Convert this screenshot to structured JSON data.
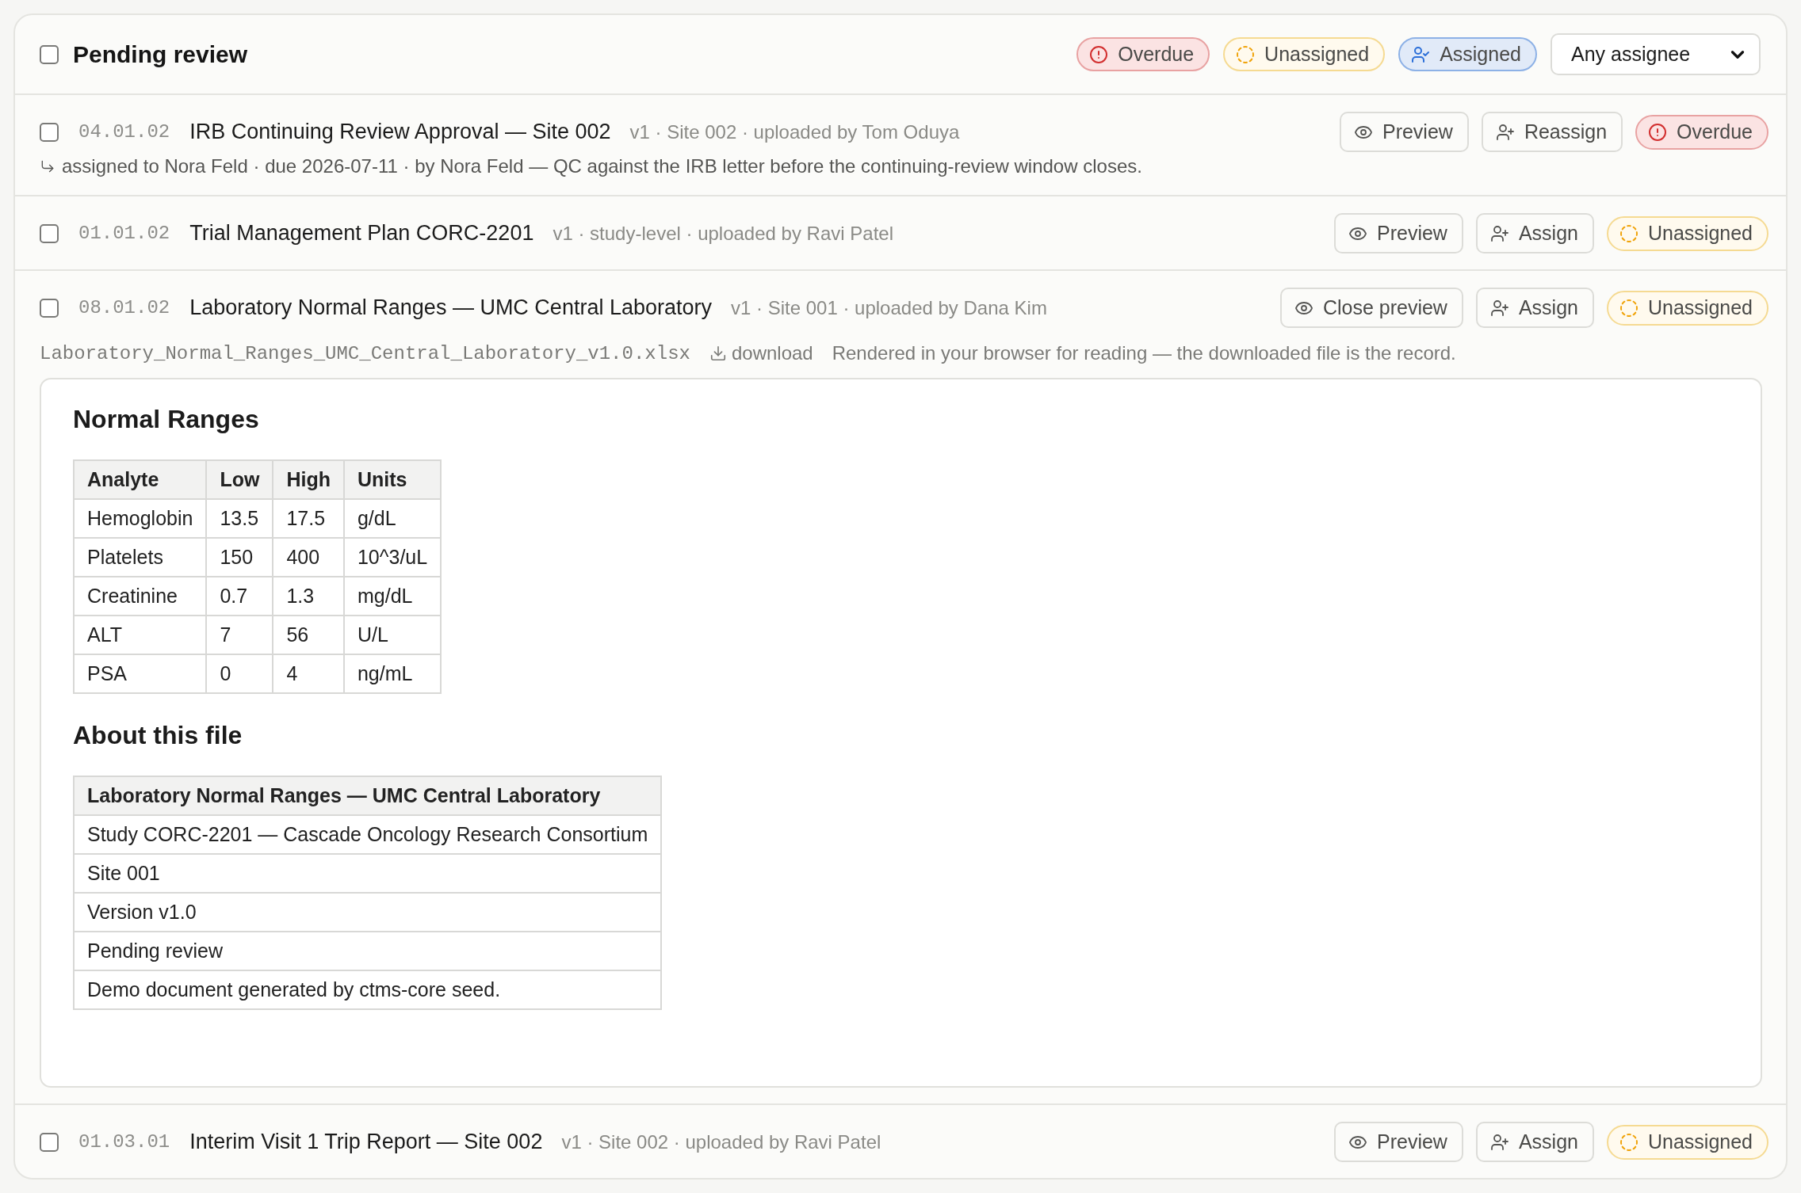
{
  "header": {
    "checked": false,
    "title": "Pending review",
    "filters": [
      {
        "kind": "overdue",
        "label": "Overdue"
      },
      {
        "kind": "unassigned",
        "label": "Unassigned"
      },
      {
        "kind": "assigned",
        "label": "Assigned"
      }
    ],
    "assignee_select": {
      "value": "Any assignee"
    }
  },
  "documents": [
    {
      "checked": false,
      "code": "04.01.02",
      "title": "IRB Continuing Review Approval — Site 002",
      "meta": "v1 · Site 002 · uploaded by Tom Oduya",
      "actions": [
        {
          "kind": "preview",
          "label": "Preview"
        },
        {
          "kind": "assign",
          "label": "Reassign"
        }
      ],
      "status": {
        "kind": "overdue",
        "label": "Overdue"
      },
      "assignment_note": "assigned to Nora Feld · due 2026-07-11 · by Nora Feld — QC against the IRB letter before the continuing-review window closes."
    },
    {
      "checked": false,
      "code": "01.01.02",
      "title": "Trial Management Plan CORC-2201",
      "meta": "v1 · study-level · uploaded by Ravi Patel",
      "actions": [
        {
          "kind": "preview",
          "label": "Preview"
        },
        {
          "kind": "assign",
          "label": "Assign"
        }
      ],
      "status": {
        "kind": "unassigned",
        "label": "Unassigned"
      }
    },
    {
      "checked": false,
      "code": "08.01.02",
      "title": "Laboratory Normal Ranges — UMC Central Laboratory",
      "meta": "v1 · Site 001 · uploaded by Dana Kim",
      "actions": [
        {
          "kind": "preview",
          "label": "Close preview"
        },
        {
          "kind": "assign",
          "label": "Assign"
        }
      ],
      "status": {
        "kind": "unassigned",
        "label": "Unassigned"
      },
      "preview": {
        "filename": "Laboratory_Normal_Ranges_UMC_Central_Laboratory_v1.0.xlsx",
        "download_label": "download",
        "note": "Rendered in your browser for reading — the downloaded file is the record.",
        "sections": [
          {
            "heading": "Normal Ranges",
            "columns": [
              "Analyte",
              "Low",
              "High",
              "Units"
            ],
            "rows": [
              [
                "Hemoglobin",
                "13.5",
                "17.5",
                "g/dL"
              ],
              [
                "Platelets",
                "150",
                "400",
                "10^3/uL"
              ],
              [
                "Creatinine",
                "0.7",
                "1.3",
                "mg/dL"
              ],
              [
                "ALT",
                "7",
                "56",
                "U/L"
              ],
              [
                "PSA",
                "0",
                "4",
                "ng/mL"
              ]
            ]
          },
          {
            "heading": "About this file",
            "columns": [
              "Laboratory Normal Ranges — UMC Central Laboratory"
            ],
            "rows": [
              [
                "Study CORC-2201 — Cascade Oncology Research Consortium"
              ],
              [
                "Site 001"
              ],
              [
                "Version v1.0"
              ],
              [
                "Pending review"
              ],
              [
                "Demo document generated by ctms-core seed."
              ]
            ]
          }
        ]
      }
    },
    {
      "checked": false,
      "code": "01.03.01",
      "title": "Interim Visit 1 Trip Report — Site 002",
      "meta": "v1 · Site 002 · uploaded by Ravi Patel",
      "actions": [
        {
          "kind": "preview",
          "label": "Preview"
        },
        {
          "kind": "assign",
          "label": "Assign"
        }
      ],
      "status": {
        "kind": "unassigned",
        "label": "Unassigned"
      }
    }
  ]
}
